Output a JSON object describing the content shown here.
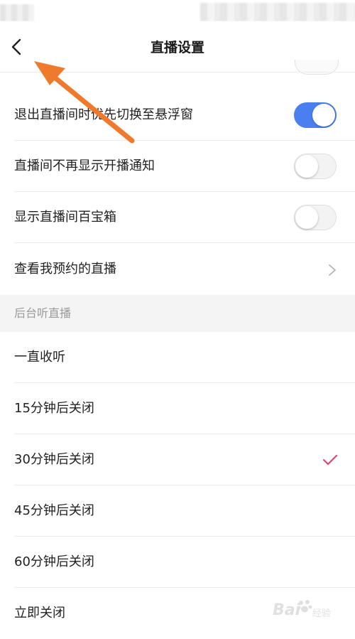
{
  "header": {
    "title": "直播设置"
  },
  "settings": [
    {
      "label": "退出直播间时优先切换至悬浮窗",
      "control": "toggle",
      "on": true
    },
    {
      "label": "直播间不再显示开播通知",
      "control": "toggle",
      "on": false
    },
    {
      "label": "显示直播间百宝箱",
      "control": "toggle",
      "on": false
    },
    {
      "label": "查看我预约的直播",
      "control": "chevron"
    }
  ],
  "background_listening": {
    "header": "后台听直播",
    "options": [
      {
        "label": "一直收听",
        "selected": false
      },
      {
        "label": "15分钟后关闭",
        "selected": false
      },
      {
        "label": "30分钟后关闭",
        "selected": true
      },
      {
        "label": "45分钟后关闭",
        "selected": false
      },
      {
        "label": "60分钟后关闭",
        "selected": false
      },
      {
        "label": "立即关闭",
        "selected": false
      }
    ]
  },
  "watermark": {
    "text": "Bai",
    "subtext": "经验"
  },
  "colors": {
    "toggle_on": "#4a7ff0",
    "checkmark": "#e0466e",
    "annotation_arrow": "#f07a2c",
    "section_bg": "#f4f4f4"
  },
  "icons": {
    "back": "chevron-left-icon",
    "more": "chevron-right-icon",
    "selected": "checkmark-icon"
  }
}
